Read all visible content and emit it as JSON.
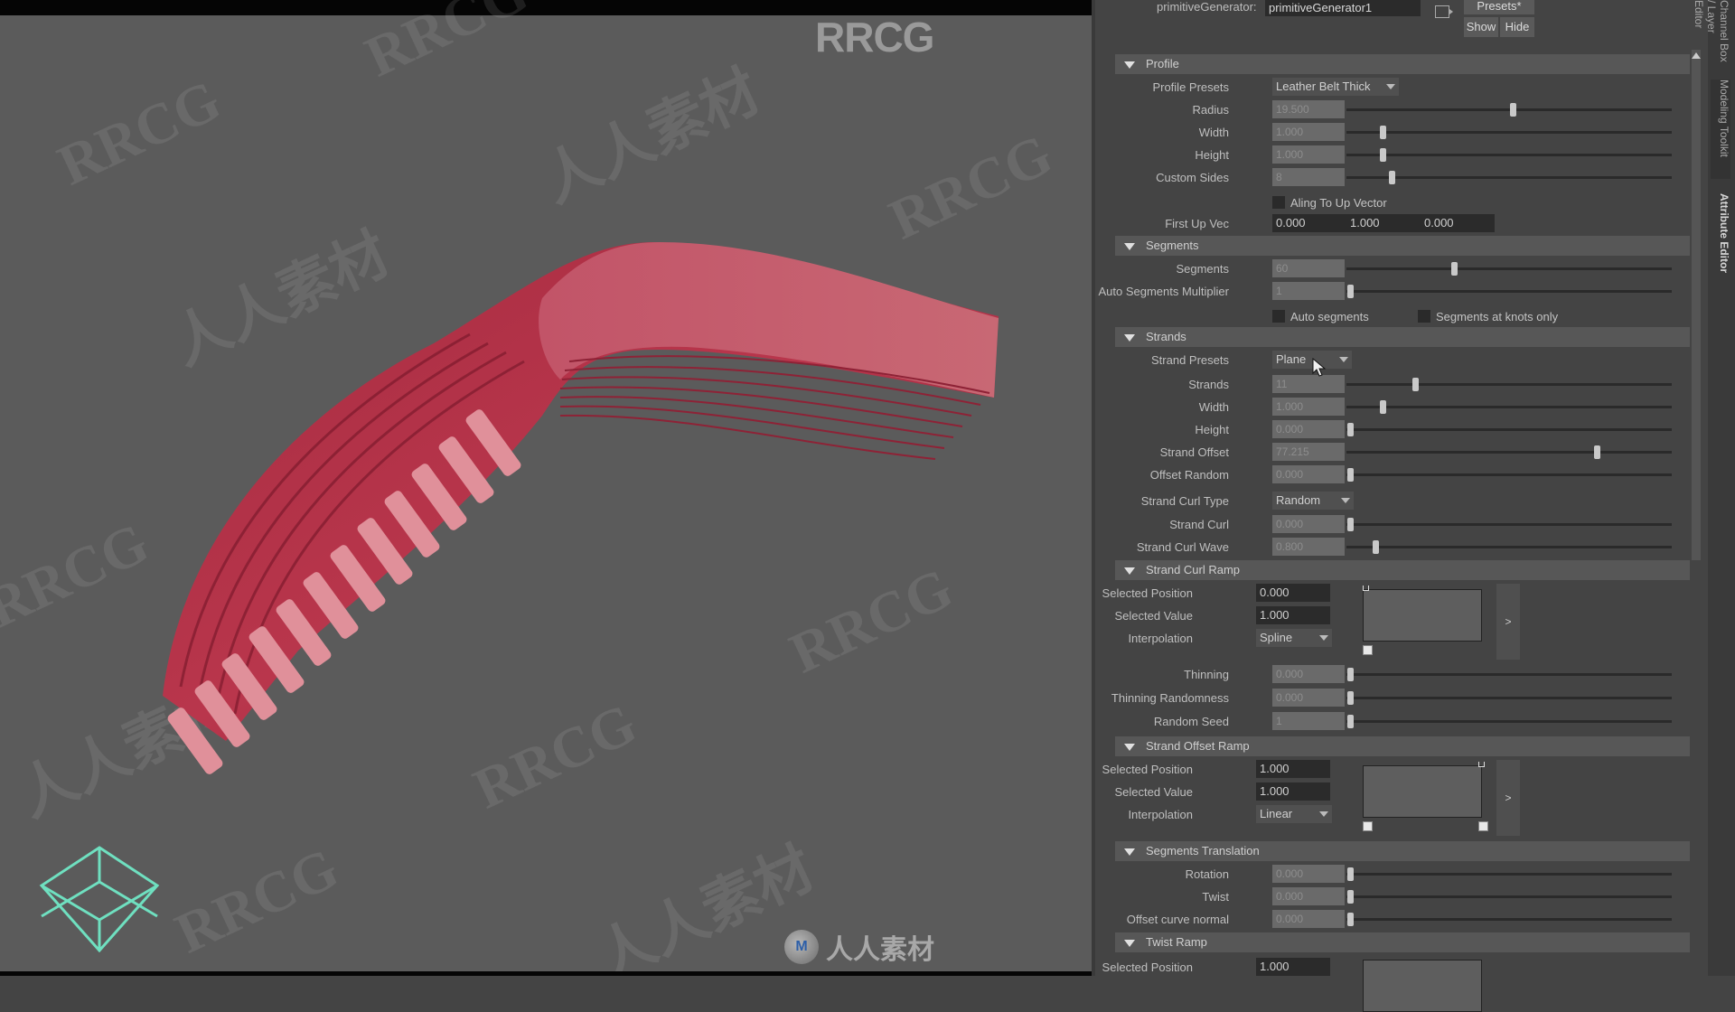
{
  "viewport": {
    "brand_text": "RRCG",
    "watermark_latin": "RRCG",
    "watermark_cjk": "人人素材",
    "bottom_logo_text": "人人素材",
    "bottom_logo_badge": "M",
    "view_cube_icon": "view-cube-icon",
    "model_color": "#c0505e",
    "accent_cube_color": "#6fe0c0"
  },
  "header": {
    "node_label": "primitiveGenerator:",
    "node_value": "primitiveGenerator1",
    "presets_label": "Presets*",
    "show_label": "Show",
    "hide_label": "Hide"
  },
  "side_tabs": [
    "Channel Box / Layer Editor",
    "Modeling Toolkit",
    "Attribute Editor"
  ],
  "profile": {
    "title": "Profile",
    "presets_label": "Profile Presets",
    "presets_value": "Leather Belt Thick",
    "sliders": [
      {
        "label": "Radius",
        "value": "19.500",
        "position": 0.51
      },
      {
        "label": "Width",
        "value": "1.000",
        "position": 0.11
      },
      {
        "label": "Height",
        "value": "1.000",
        "position": 0.11
      },
      {
        "label": "Custom Sides",
        "value": "8",
        "position": 0.14
      }
    ],
    "align_label": "Aling To Up Vector",
    "up_vec_label": "First Up Vec",
    "up_vec": [
      "0.000",
      "1.000",
      "0.000"
    ]
  },
  "segments": {
    "title": "Segments",
    "sliders": [
      {
        "label": "Segments",
        "value": "60",
        "position": 0.33
      },
      {
        "label": "Auto Segments Multiplier",
        "value": "1",
        "position": 0.01
      }
    ],
    "auto_segments_label": "Auto segments",
    "knots_only_label": "Segments at knots only"
  },
  "strands": {
    "title": "Strands",
    "presets_label": "Strand Presets",
    "presets_value": "Plane",
    "sliders": [
      {
        "label": "Strands",
        "value": "11",
        "position": 0.21
      },
      {
        "label": "Width",
        "value": "1.000",
        "position": 0.11
      },
      {
        "label": "Height",
        "value": "0.000",
        "position": 0.01
      },
      {
        "label": "Strand Offset",
        "value": "77.215",
        "position": 0.77
      },
      {
        "label": "Offset Random",
        "value": "0.000",
        "position": 0.01
      }
    ],
    "curl_type_label": "Strand Curl Type",
    "curl_type_value": "Random",
    "curl_sliders": [
      {
        "label": "Strand Curl",
        "value": "0.000",
        "position": 0.01
      },
      {
        "label": "Strand Curl Wave",
        "value": "0.800",
        "position": 0.09
      }
    ]
  },
  "strand_curl_ramp": {
    "title": "Strand Curl Ramp",
    "position_label": "Selected Position",
    "position_value": "0.000",
    "value_label": "Selected Value",
    "value_value": "1.000",
    "interp_label": "Interpolation",
    "interp_value": "Spline",
    "expand_label": ">"
  },
  "thinning": {
    "sliders": [
      {
        "label": "Thinning",
        "value": "0.000",
        "position": 0.01
      },
      {
        "label": "Thinning Randomness",
        "value": "0.000",
        "position": 0.01
      },
      {
        "label": "Random Seed",
        "value": "1",
        "position": 0.01
      }
    ]
  },
  "strand_offset_ramp": {
    "title": "Strand Offset Ramp",
    "position_label": "Selected Position",
    "position_value": "1.000",
    "value_label": "Selected Value",
    "value_value": "1.000",
    "interp_label": "Interpolation",
    "interp_value": "Linear",
    "expand_label": ">"
  },
  "segments_translation": {
    "title": "Segments Translation",
    "sliders": [
      {
        "label": "Rotation",
        "value": "0.000",
        "position": 0.01
      },
      {
        "label": "Twist",
        "value": "0.000",
        "position": 0.01
      },
      {
        "label": "Offset curve normal",
        "value": "0.000",
        "position": 0.01
      }
    ]
  },
  "twist_ramp": {
    "title": "Twist Ramp",
    "position_label": "Selected Position",
    "position_value": "1.000"
  }
}
